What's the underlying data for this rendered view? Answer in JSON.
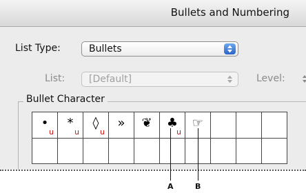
{
  "dialog": {
    "title": "Bullets and Numbering"
  },
  "list_type": {
    "label": "List Type:",
    "value": "Bullets"
  },
  "list": {
    "label": "List:",
    "value": "[Default]"
  },
  "level": {
    "label": "Level:"
  },
  "bullet_character": {
    "legend": "Bullet Character",
    "cells": [
      {
        "glyph": "•",
        "marker": "u"
      },
      {
        "glyph": "*",
        "marker": "u"
      },
      {
        "glyph": "◊",
        "marker": "u"
      },
      {
        "glyph": "»",
        "marker": ""
      },
      {
        "glyph": "❦",
        "marker": ""
      },
      {
        "glyph": "♣",
        "marker": "u"
      },
      {
        "glyph": "☞",
        "marker": ""
      },
      {
        "glyph": "",
        "marker": ""
      },
      {
        "glyph": "",
        "marker": ""
      },
      {
        "glyph": "",
        "marker": ""
      }
    ]
  },
  "callouts": {
    "a": "A",
    "b": "B"
  },
  "colors": {
    "accent": "#2a63c9",
    "marker": "#d01010"
  },
  "icons": {
    "dropdown": "up-down-arrows-icon"
  }
}
